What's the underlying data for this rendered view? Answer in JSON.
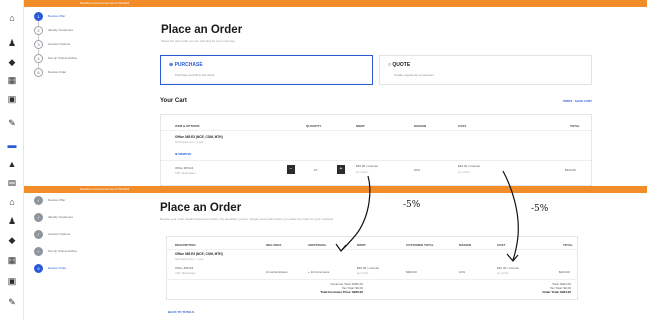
{
  "top": {
    "banner_text": "Sandbox environment as of 7/1/2024",
    "steps": [
      {
        "num": "1",
        "label": "Review Offer"
      },
      {
        "num": "2",
        "label": "Identify Customers"
      },
      {
        "num": "3",
        "label": "Account Options"
      },
      {
        "num": "4",
        "label": "Set Up Trial and More"
      },
      {
        "num": "5",
        "label": "Review Order"
      }
    ],
    "page_title": "Place an Order",
    "page_subtitle": "Select the items that you are ordering for your customer",
    "purchase": {
      "label": "PURCHASE",
      "sub": "Purchase and bill to the client"
    },
    "quote": {
      "label": "QUOTE",
      "sub": "Create a quote for a customer"
    },
    "cart": {
      "heading": "Your Cart",
      "print_action": "PRINT · SAVE CART",
      "columns": [
        "ITEM & OPTIONS",
        "QUANTITY",
        "MSRP",
        "MARGIN",
        "COST",
        "TOTAL"
      ],
      "product_name": "Office 365 E3 (NCE, COM, MTH)",
      "product_sub": "Subscription term · 1 year",
      "remove_label": "REMOVE",
      "line_name": "Office 365 E3",
      "line_sub": "CSP / Marketplace",
      "quantity": "10",
      "msrp": "$36.00 / License",
      "msrp_sub": "per month",
      "margin": "20%",
      "cost": "$32.40 / License",
      "cost_sub": "per month",
      "total": "$324.00"
    }
  },
  "bottom": {
    "banner_text": "Sandbox environment as of 7/1/2024",
    "steps": [
      {
        "num": "✓",
        "label": "Review Offer"
      },
      {
        "num": "✓",
        "label": "Identify Customers"
      },
      {
        "num": "✓",
        "label": "Account Options"
      },
      {
        "num": "✓",
        "label": "Set Up Trial and More"
      },
      {
        "num": "5",
        "label": "Review Order"
      }
    ],
    "page_title": "Place an Order",
    "page_subtitle": "Review your order details below and confirm the quantities, prices, margins and totals before you place the order for your customer",
    "columns": [
      "DESCRIPTION",
      "INCLUDES",
      "ADDITIONAL",
      "MSRP",
      "CUSTOMER TOTAL",
      "MARGIN",
      "COST",
      "TOTAL"
    ],
    "product_name": "Office 365 E3 (NCE, COM, MTH)",
    "product_sub": "Subscription term · 1 year",
    "line_name": "Office 365 E3",
    "line_sub": "CSP / Marketplace",
    "includes": "10 subscriptions",
    "additional": "+ 10 increments",
    "msrp": "$36.00 / License",
    "msrp_sub": "per month",
    "customer_total": "$360.00",
    "margin": "10%",
    "cost": "$32.40 / License",
    "cost_sub": "per month",
    "total": "$324.00",
    "customer_total_label": "Customer Total: $360.00",
    "customer_tax": "Tax Total: $0.00",
    "customer_price": "Total Customer Price: $360.00",
    "order_total_label": "Total: $324.00",
    "order_tax": "Tax Total: $0.00",
    "order_total": "Order Total: $324.00",
    "back_link": "BACK TO TOTALS"
  },
  "annotations": {
    "left": "-5%",
    "right": "-5%"
  },
  "colors": {
    "accent": "#2a5bd7",
    "banner": "#f28c28"
  },
  "icons": {
    "top": [
      "home-icon",
      "users-icon",
      "tag-icon",
      "grid-icon",
      "monitor-icon",
      "wrench-icon",
      "cart-icon",
      "building-icon",
      "table-icon"
    ],
    "bottom": [
      "home-icon",
      "users-icon",
      "tag-icon",
      "grid-icon",
      "monitor-icon",
      "wrench-icon"
    ]
  }
}
